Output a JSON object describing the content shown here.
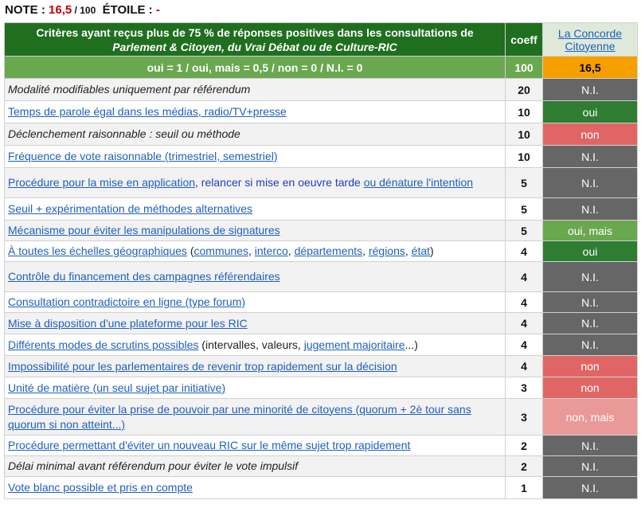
{
  "note": {
    "label": "NOTE",
    "sep1": " : ",
    "score": "16,5",
    "sep2": " / ",
    "max": "100",
    "etoile_label": "ÉTOILE",
    "sep3": " : ",
    "etoile_value": "-"
  },
  "header": {
    "criteria_line1": "Critères ayant reçus  plus de  75 % de réponses positives dans les consultations de",
    "criteria_line2": "Parlement & Citoyen, du Vrai Débat ou de Culture-RIC",
    "coeff": "coeff",
    "list_name": "La Concorde Citoyenne"
  },
  "scale": {
    "legend": "oui = 1   /   oui, mais = 0,5   /   non = 0   /   N.I. = 0",
    "total_coeff": "100",
    "total_score": "16,5"
  },
  "rows": [
    {
      "parts": [
        {
          "t": "Modalité modifiables uniquement par référendum",
          "s": "ital"
        }
      ],
      "coeff": "20",
      "value": "N.I.",
      "cls": "v-ni",
      "h": 28
    },
    {
      "parts": [
        {
          "t": "Temps de parole égal dans les médias, radio/TV+presse",
          "s": "lnk"
        }
      ],
      "coeff": "10",
      "value": "oui",
      "cls": "v-oui",
      "h": 28
    },
    {
      "parts": [
        {
          "t": "Déclenchement raisonnable : seuil ou méthode",
          "s": "ital"
        }
      ],
      "coeff": "10",
      "value": "non",
      "cls": "v-non",
      "h": 28
    },
    {
      "parts": [
        {
          "t": "Fréquence de vote raisonnable (trimestriel, semestriel)",
          "s": "lnk"
        }
      ],
      "coeff": "10",
      "value": "N.I.",
      "cls": "v-ni",
      "h": 28
    },
    {
      "parts": [
        {
          "t": "Procédure pour la mise en application",
          "s": "lnk"
        },
        {
          "t": ", relancer si mise en oeuvre tarde ",
          "s": "bluetxt"
        },
        {
          "t": "ou dénature l'intention",
          "s": "lnk"
        }
      ],
      "coeff": "5",
      "value": "N.I.",
      "cls": "v-ni",
      "h": 38
    },
    {
      "parts": [
        {
          "t": "Seuil + expérimentation de méthodes alternatives",
          "s": "lnk"
        }
      ],
      "coeff": "5",
      "value": "N.I.",
      "cls": "v-ni",
      "h": 28
    },
    {
      "parts": [
        {
          "t": "Mécanisme pour éviter les manipulations de signatures",
          "s": "lnk"
        }
      ],
      "coeff": "5",
      "value": "oui, mais",
      "cls": "v-ouimais",
      "h": 26
    },
    {
      "parts": [
        {
          "t": "À toutes les échelles géographiques",
          "s": "lnk"
        },
        {
          "t": " (",
          "s": "plain"
        },
        {
          "t": "communes",
          "s": "lnk"
        },
        {
          "t": ", ",
          "s": "plain"
        },
        {
          "t": "interco",
          "s": "lnk"
        },
        {
          "t": ", ",
          "s": "plain"
        },
        {
          "t": "départements",
          "s": "lnk"
        },
        {
          "t": ", ",
          "s": "plain"
        },
        {
          "t": "régions",
          "s": "lnk"
        },
        {
          "t": ", ",
          "s": "plain"
        },
        {
          "t": "état",
          "s": "lnk"
        },
        {
          "t": ")",
          "s": "plain"
        }
      ],
      "coeff": "4",
      "value": "oui",
      "cls": "v-oui",
      "h": 26
    },
    {
      "parts": [
        {
          "t": "Contrôle du financement des campagnes référendaires",
          "s": "lnk"
        }
      ],
      "coeff": "4",
      "value": "N.I.",
      "cls": "v-ni",
      "h": 38
    },
    {
      "parts": [
        {
          "t": "Consultation contradictoire en ligne (type forum)",
          "s": "lnk"
        }
      ],
      "coeff": "4",
      "value": "N.I.",
      "cls": "v-ni",
      "h": 26
    },
    {
      "parts": [
        {
          "t": "Mise à disposition d'une plateforme pour les RIC",
          "s": "lnk"
        }
      ],
      "coeff": "4",
      "value": "N.I.",
      "cls": "v-ni",
      "h": 27
    },
    {
      "parts": [
        {
          "t": "Différents modes de scrutins possibles",
          "s": "lnk"
        },
        {
          "t": " (intervalles, valeurs, ",
          "s": "plain"
        },
        {
          "t": "jugement majoritaire",
          "s": "lnk"
        },
        {
          "t": "...)",
          "s": "plain"
        }
      ],
      "coeff": "4",
      "value": "N.I.",
      "cls": "v-ni",
      "h": 27
    },
    {
      "parts": [
        {
          "t": "Impossibilité pour les parlementaires de revenir trop rapidement sur la décision",
          "s": "lnk"
        }
      ],
      "coeff": "4",
      "value": "non",
      "cls": "v-non",
      "h": 27
    },
    {
      "parts": [
        {
          "t": "Unité de matière (un seul sujet par initiative)",
          "s": "lnk"
        }
      ],
      "coeff": "3",
      "value": "non",
      "cls": "v-non",
      "h": 27
    },
    {
      "parts": [
        {
          "t": "Procédure pour éviter la prise de pouvoir par une minorité de citoyens (quorum + 2è tour sans quorum si non atteint...)",
          "s": "lnk"
        }
      ],
      "coeff": "3",
      "value": "non, mais",
      "cls": "v-nonmais",
      "h": 46
    },
    {
      "parts": [
        {
          "t": "Procédure permettant d'éviter un nouveau RIC sur le même sujet trop rapidement",
          "s": "lnk"
        }
      ],
      "coeff": "2",
      "value": "N.I.",
      "cls": "v-ni",
      "h": 26
    },
    {
      "parts": [
        {
          "t": "Délai minimal avant référendum pour éviter le vote impulsif",
          "s": "ital"
        }
      ],
      "coeff": "2",
      "value": "N.I.",
      "cls": "v-ni",
      "h": 26
    },
    {
      "parts": [
        {
          "t": "Vote blanc possible et pris en compte",
          "s": "lnk"
        }
      ],
      "coeff": "1",
      "value": "N.I.",
      "cls": "v-ni",
      "h": 28
    }
  ]
}
